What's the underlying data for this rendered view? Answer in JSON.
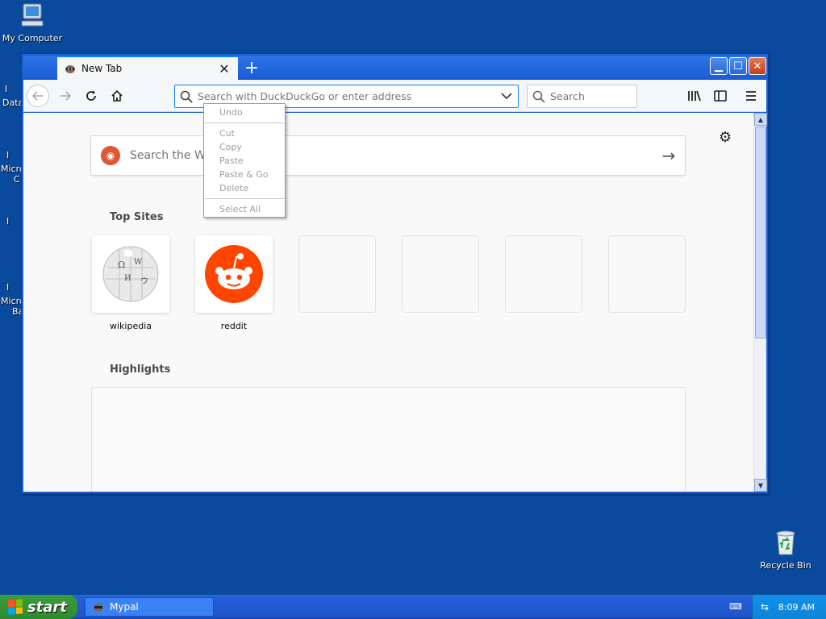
{
  "desktop": {
    "my_computer_label": "My Computer",
    "recycle_bin_label": "Recycle Bin",
    "partial_labels": [
      "I",
      "Data",
      "I",
      "Micro",
      "C",
      "I",
      "I",
      "Micro",
      "Ba"
    ]
  },
  "browser": {
    "tab_title": "New Tab",
    "url_placeholder": "Search with DuckDuckGo or enter address",
    "search_placeholder": "Search",
    "content_search_placeholder": "Search the Web",
    "top_sites_title": "Top Sites",
    "highlights_title": "Highlights",
    "top_sites": [
      {
        "name": "wikipedia"
      },
      {
        "name": "reddit"
      }
    ]
  },
  "context_menu": {
    "items": [
      "Undo",
      "Cut",
      "Copy",
      "Paste",
      "Paste & Go",
      "Delete",
      "Select All"
    ]
  },
  "taskbar": {
    "start_label": "start",
    "task_label": "Mypal",
    "clock": "8:09 AM"
  },
  "colors": {
    "desktop": "#0a4a9c",
    "accent": "#0a84ff",
    "reddit": "#ff4500"
  }
}
